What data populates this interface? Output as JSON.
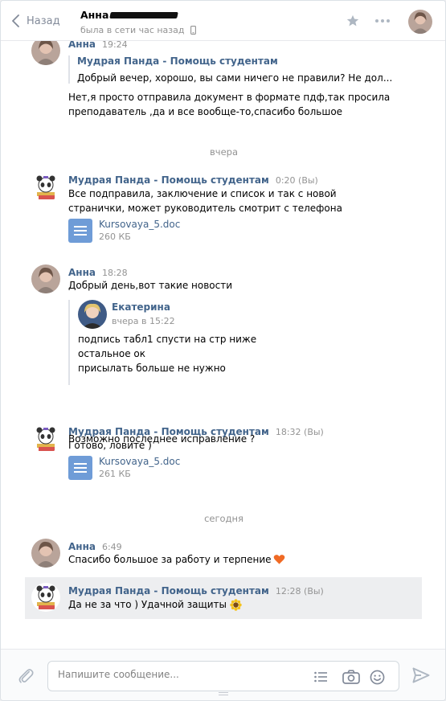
{
  "header": {
    "back_label": "Назад",
    "peer_name": "Анна",
    "peer_status": "была в сети час назад"
  },
  "composer": {
    "placeholder": "Напишите сообщение..."
  },
  "date_separators": [
    "вчера",
    "сегодня"
  ],
  "messages": [
    {
      "author": "Анна",
      "time": "19:24",
      "quote": {
        "author": "Мудрая Панда - Помощь студентам",
        "text": "Добрый вечер, хорошо, вы сами ничего не правили? Не дол..."
      },
      "lines": [
        "Нет,я просто отправила документ в формате пдф,так просила",
        "преподаватель ,да и все вообще-то,спасибо большое"
      ]
    },
    {
      "author": "Мудрая Панда - Помощь студентам",
      "time": "0:20 (Вы)",
      "lines": [
        "Все подправила, заключение и список и так с новой",
        "странички, может руководитель смотрит с телефона"
      ],
      "doc": {
        "name": "Kursovaya_5.doc",
        "size": "260 КБ"
      }
    },
    {
      "author": "Анна",
      "time": "18:28",
      "lines": [
        "Добрый день,вот такие новости"
      ],
      "forward": {
        "author": "Екатерина",
        "time": "вчера в 15:22",
        "lines": [
          "подпись табл1 спусти на стр ниже",
          "остальное ок",
          "присылать больше не нужно"
        ]
      },
      "after": "Возможно последнее исправление ?"
    },
    {
      "author": "Мудрая Панда - Помощь студентам",
      "time": "18:32 (Вы)",
      "lines": [
        "Готово, ловите )"
      ],
      "doc": {
        "name": "Kursovaya_5.doc",
        "size": "261 КБ"
      }
    },
    {
      "author": "Анна",
      "time": "6:49",
      "lines": [
        "Спасибо большое за работу и терпение"
      ]
    },
    {
      "author": "Мудрая Панда - Помощь студентам",
      "time": "12:28 (Вы)",
      "lines": [
        "Да не за что ) Удачной защиты"
      ]
    }
  ],
  "icons": {
    "back": "chevron-left-icon",
    "star": "star-icon",
    "more": "more-dots-icon",
    "attach": "paperclip-icon",
    "templates": "list-icon",
    "camera": "camera-icon",
    "emoji": "smile-icon",
    "send": "send-icon",
    "mobile": "mobile-icon",
    "heart": "heart-emoji-icon",
    "sunflower": "sunflower-emoji-icon"
  },
  "colors": {
    "link": "#42648b",
    "muted": "#939393",
    "highlight": "#edeef0",
    "doc": "#6f9cd7"
  }
}
